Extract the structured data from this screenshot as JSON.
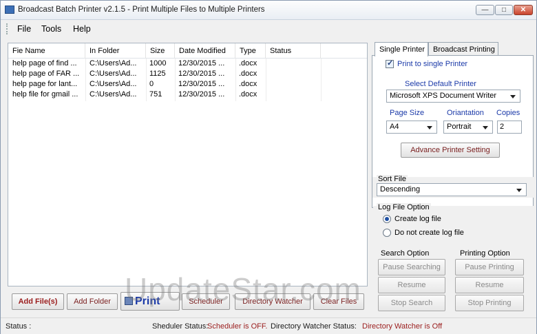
{
  "window": {
    "title": "Broadcast Batch Printer v2.1.5 - Print Multiple Files to Multiple Printers",
    "min": "—",
    "max": "□",
    "close": "✕"
  },
  "menu": {
    "file": "File",
    "tools": "Tools",
    "help": "Help"
  },
  "table": {
    "headers": {
      "name": "Fie Name",
      "folder": "In Folder",
      "size": "Size",
      "date": "Date Modified",
      "type": "Type",
      "status": "Status"
    },
    "rows": [
      {
        "name": "help page of find ...",
        "folder": "C:\\Users\\Ad...",
        "size": "1000",
        "date": "12/30/2015 ...",
        "type": ".docx",
        "status": ""
      },
      {
        "name": "help page of FAR ...",
        "folder": "C:\\Users\\Ad...",
        "size": "1125",
        "date": "12/30/2015 ...",
        "type": ".docx",
        "status": ""
      },
      {
        "name": "help page for lant...",
        "folder": "C:\\Users\\Ad...",
        "size": "0",
        "date": "12/30/2015 ...",
        "type": ".docx",
        "status": ""
      },
      {
        "name": "help file for gmail ...",
        "folder": "C:\\Users\\Ad...",
        "size": "751",
        "date": "12/30/2015 ...",
        "type": ".docx",
        "status": ""
      }
    ]
  },
  "buttons": {
    "add_files": "Add File(s)",
    "add_folder": "Add Folder",
    "print": "Print",
    "scheduler": "Scheduler",
    "directory_watcher": "Directory Watcher",
    "clear_files": "Clear Files"
  },
  "status": {
    "label": "Status :",
    "scheduler_label": "Sheduler Status:",
    "scheduler_value": "Scheduler is OFF.",
    "watcher_label": "Directory Watcher Status:",
    "watcher_value": "Directory Watcher is Off"
  },
  "tabs": {
    "single": "Single Printer",
    "broadcast": "Broadcast Printing"
  },
  "single_printer": {
    "checkbox_label": "Print to single Printer",
    "select_default_label": "Select Default Printer",
    "default_printer": "Microsoft XPS Document Writer",
    "page_size_label": "Page Size",
    "page_size": "A4",
    "orientation_label": "Oriantation",
    "orientation": "Portrait",
    "copies_label": "Copies",
    "copies": "2",
    "advance_button": "Advance Printer Setting"
  },
  "sort": {
    "label": "Sort File",
    "value": "Descending"
  },
  "log": {
    "label": "Log File Option",
    "create": "Create log file",
    "no_create": "Do not create log file"
  },
  "search_option": {
    "label": "Search Option",
    "pause": "Pause Searching",
    "resume": "Resume",
    "stop": "Stop Search"
  },
  "printing_option": {
    "label": "Printing Option",
    "pause": "Pause Printing",
    "resume": "Resume",
    "stop": "Stop Printing"
  },
  "watermark": "UpdateStar.com"
}
